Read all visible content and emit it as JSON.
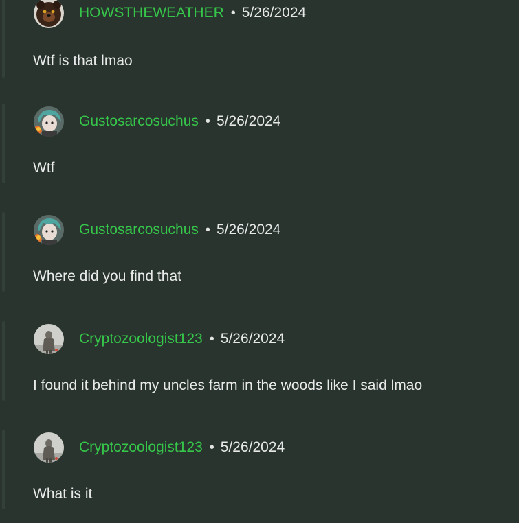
{
  "comments": [
    {
      "username": "HOWSTHEWEATHER",
      "separator": "•",
      "date": "5/26/2024",
      "text": "Wtf is that lmao",
      "avatar_icon": "bear-avatar-icon"
    },
    {
      "username": "Gustosarcosuchus",
      "separator": "•",
      "date": "5/26/2024",
      "text": "Wtf",
      "avatar_icon": "anime-avatar-icon"
    },
    {
      "username": "Gustosarcosuchus",
      "separator": "•",
      "date": "5/26/2024",
      "text": "Where did you find that",
      "avatar_icon": "anime-avatar-icon"
    },
    {
      "username": "Cryptozoologist123",
      "separator": "•",
      "date": "5/26/2024",
      "text": "I found it behind my uncles farm in the woods like I said lmao",
      "avatar_icon": "figure-avatar-icon"
    },
    {
      "username": "Cryptozoologist123",
      "separator": "•",
      "date": "5/26/2024",
      "text": "What is it",
      "avatar_icon": "figure-avatar-icon"
    }
  ],
  "colors": {
    "background": "#29342f",
    "username": "#36c74a",
    "text": "#e9ebea"
  }
}
